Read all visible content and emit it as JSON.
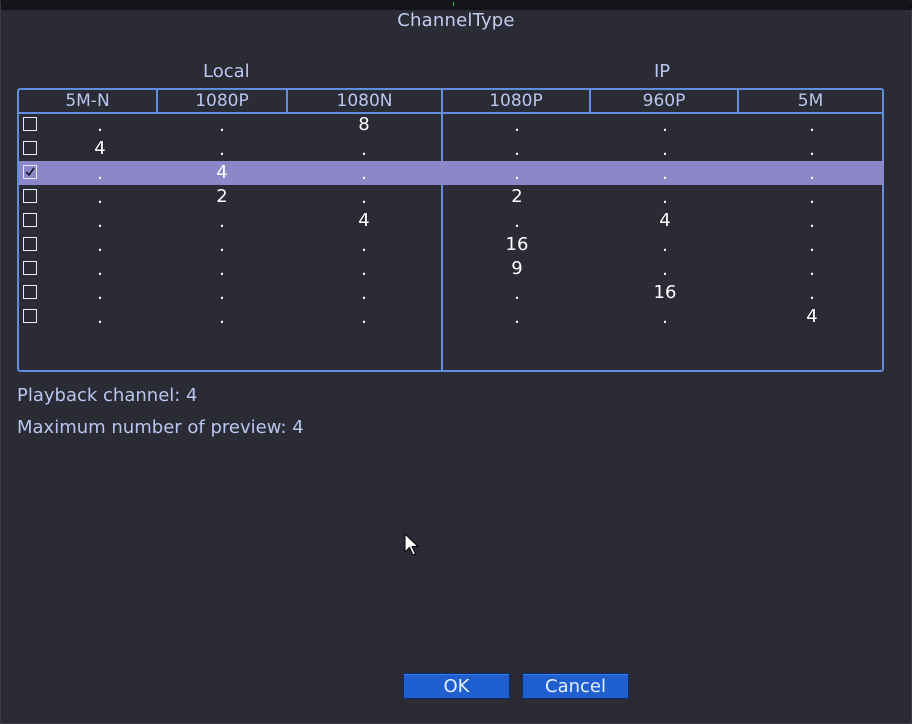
{
  "dialog": {
    "title": "ChannelType",
    "local_label": "Local",
    "ip_label": "IP"
  },
  "columns": [
    "5M-N",
    "1080P",
    "1080N",
    "1080P",
    "960P",
    "5M"
  ],
  "rows": [
    {
      "checked": false,
      "selected": false,
      "values": [
        ".",
        ".",
        "8",
        ".",
        ".",
        "."
      ]
    },
    {
      "checked": false,
      "selected": false,
      "values": [
        "4",
        ".",
        ".",
        ".",
        ".",
        "."
      ]
    },
    {
      "checked": true,
      "selected": true,
      "values": [
        ".",
        "4",
        ".",
        ".",
        ".",
        "."
      ]
    },
    {
      "checked": false,
      "selected": false,
      "values": [
        ".",
        "2",
        ".",
        "2",
        ".",
        "."
      ]
    },
    {
      "checked": false,
      "selected": false,
      "values": [
        ".",
        ".",
        "4",
        ".",
        "4",
        "."
      ]
    },
    {
      "checked": false,
      "selected": false,
      "values": [
        ".",
        ".",
        ".",
        "16",
        ".",
        "."
      ]
    },
    {
      "checked": false,
      "selected": false,
      "values": [
        ".",
        ".",
        ".",
        "9",
        ".",
        "."
      ]
    },
    {
      "checked": false,
      "selected": false,
      "values": [
        ".",
        ".",
        ".",
        ".",
        "16",
        "."
      ]
    },
    {
      "checked": false,
      "selected": false,
      "values": [
        ".",
        ".",
        ".",
        ".",
        ".",
        "4"
      ]
    }
  ],
  "info": {
    "playback_channel": "Playback channel: 4",
    "max_preview": "Maximum number of preview: 4"
  },
  "buttons": {
    "ok": "OK",
    "cancel": "Cancel"
  },
  "colors": {
    "background": "#2b2b36",
    "border": "#5f8fdc",
    "selected_row": "#8b87c9",
    "button": "#1f5fd0"
  }
}
